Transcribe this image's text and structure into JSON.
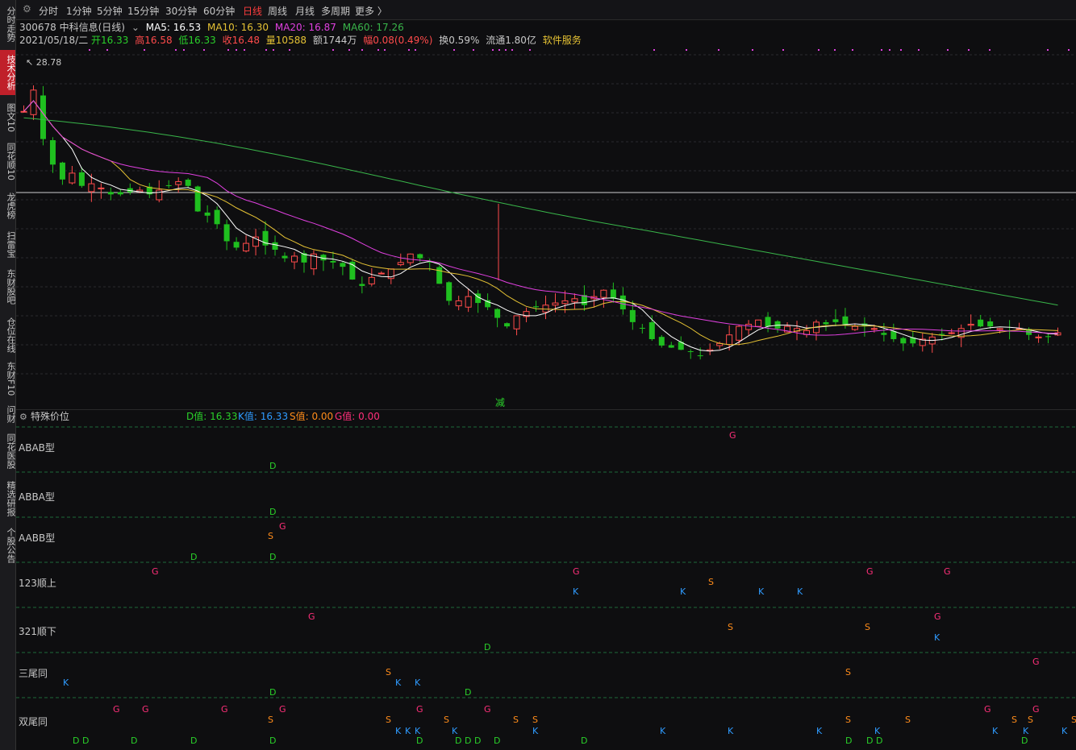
{
  "sidebar": {
    "items": [
      {
        "label": "分时走势",
        "active": false
      },
      {
        "label": "技术分析",
        "active": true
      },
      {
        "label": "图文10",
        "active": false
      },
      {
        "label": "同花顺10",
        "active": false
      },
      {
        "label": "龙虎榜",
        "active": false
      },
      {
        "label": "扫雷宝",
        "active": false
      },
      {
        "label": "东财股吧",
        "active": false
      },
      {
        "label": "仓位在线",
        "active": false
      },
      {
        "label": "东财F10",
        "active": false
      },
      {
        "label": "问财",
        "active": false
      },
      {
        "label": "同花医股",
        "active": false
      },
      {
        "label": "精选研报",
        "active": false
      },
      {
        "label": "个股公告",
        "active": false
      }
    ]
  },
  "periods": {
    "items": [
      "分时",
      "1分钟",
      "5分钟",
      "15分钟",
      "30分钟",
      "60分钟",
      "日线",
      "周线",
      "月线",
      "多周期",
      "更多 〉"
    ],
    "active": "日线"
  },
  "stock": {
    "code_name": "300678 中科信息(日线)",
    "ma5": "MA5: 16.53",
    "ma10": "MA10: 16.30",
    "ma20": "MA20: 16.87",
    "ma60": "MA60: 17.26",
    "date": "2021/05/18/二",
    "open": "开16.33",
    "high": "高16.58",
    "low": "低16.33",
    "close": "收16.48",
    "volume": "量10588",
    "amount": "额1744万",
    "change": "幅0.08(0.49%)",
    "turnover": "换0.59%",
    "float": "流通1.80亿",
    "industry": "软件服务"
  },
  "main_chart": {
    "max_label": "28.78",
    "tag": "减"
  },
  "indicator": {
    "name": "特殊价位",
    "d": "D值: 16.33",
    "k": "K值: 16.33",
    "s": "S值: 0.00",
    "g": "G值: 0.00",
    "types": [
      "ABAB型",
      "ABBA型",
      "AABB型",
      "123顺上",
      "321顺下",
      "三尾同",
      "双尾同"
    ]
  },
  "colors": {
    "up": "#ff4b4b",
    "down": "#1fbf1f",
    "ma5": "#ffffff",
    "ma10": "#e5c234",
    "ma20": "#e040e0",
    "ma60": "#39b54a",
    "d": "#2ad02a",
    "k": "#2f9bff",
    "s": "#ff8c1a",
    "g": "#ff2f7a"
  }
}
